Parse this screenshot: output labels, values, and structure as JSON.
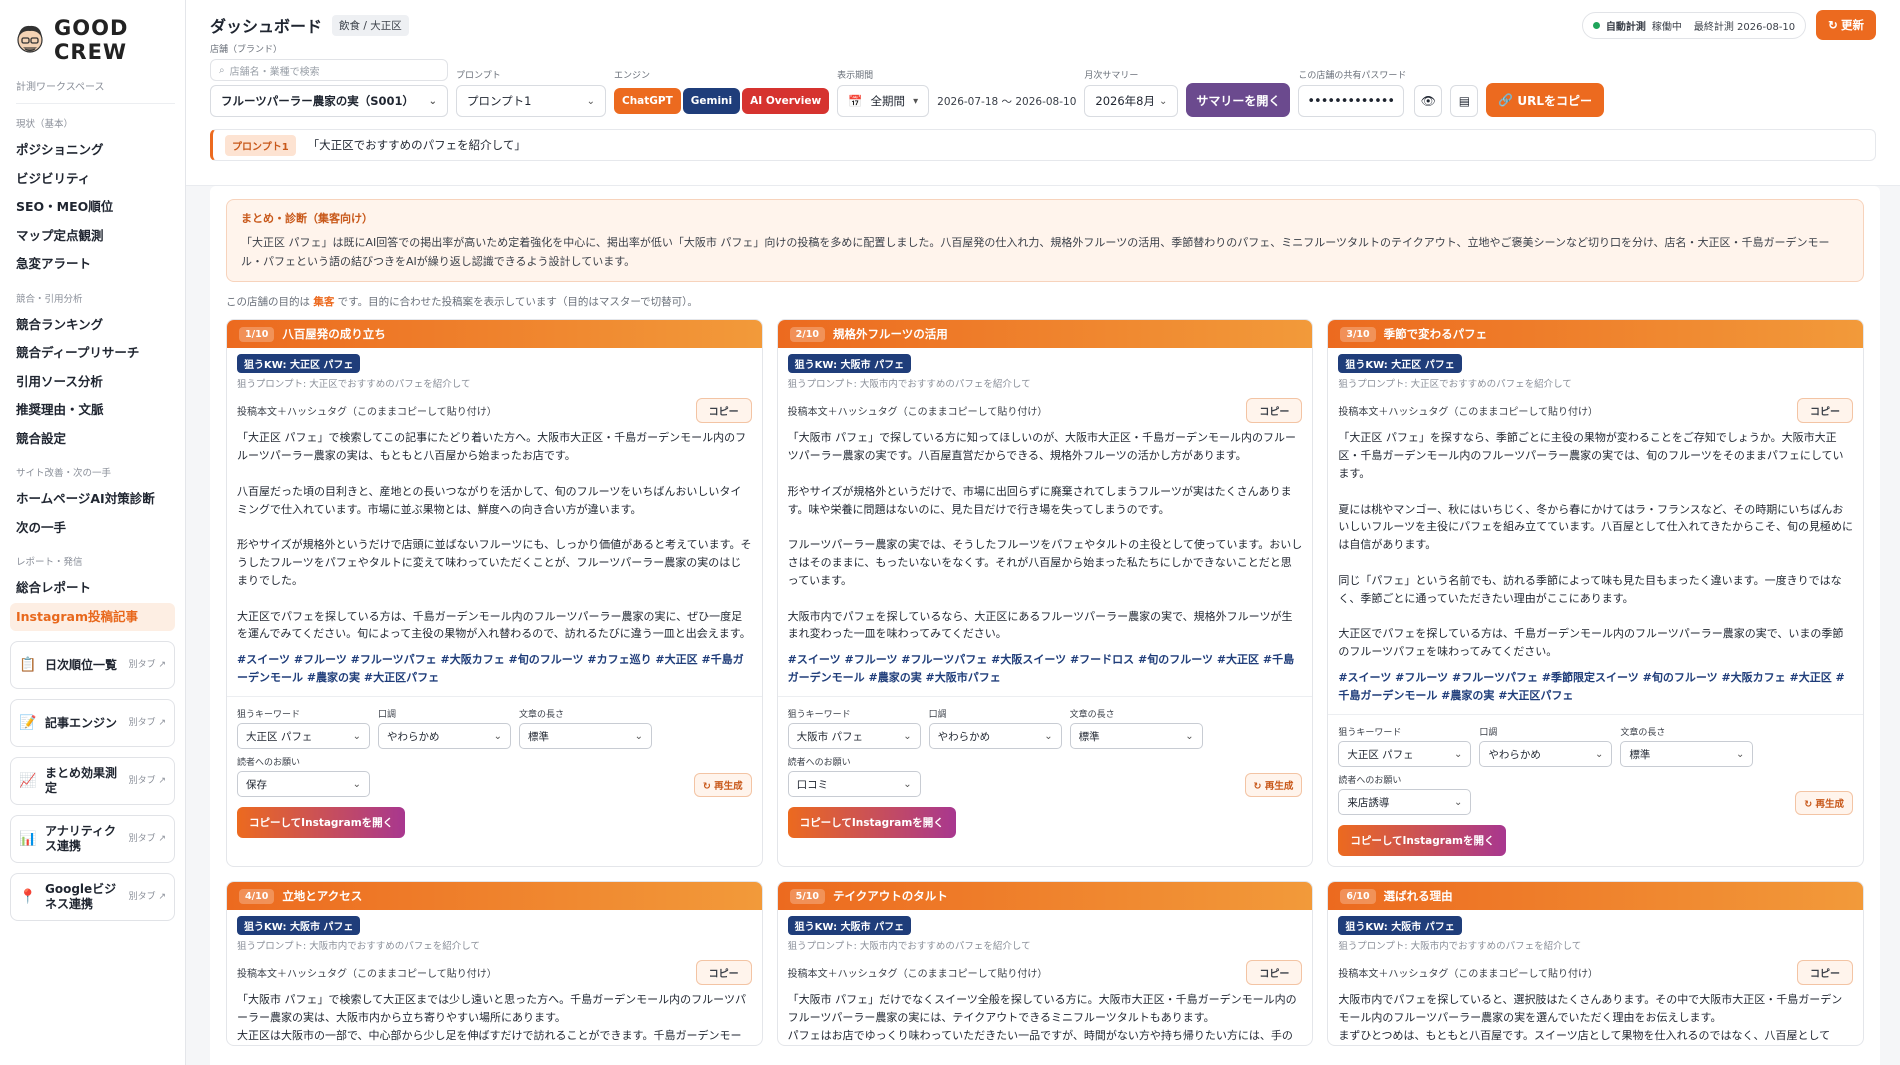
{
  "brand": {
    "name": "GOOD CREW",
    "workspace": "計測ワークスペース"
  },
  "sidebar": {
    "sections": [
      {
        "title": "現状（基本）",
        "items": [
          "ポジショニング",
          "ビジビリティ",
          "SEO・MEO順位",
          "マップ定点観測",
          "急変アラート"
        ]
      },
      {
        "title": "競合・引用分析",
        "items": [
          "競合ランキング",
          "競合ディープリサーチ",
          "引用ソース分析",
          "推奨理由・文脈",
          "競合設定"
        ]
      },
      {
        "title": "サイト改善・次の一手",
        "items": [
          "ホームページAI対策診断",
          "次の一手"
        ]
      },
      {
        "title": "レポート・発信",
        "items": [
          "総合レポート",
          "Instagram投稿記事"
        ]
      }
    ],
    "active": "Instagram投稿記事",
    "external": [
      {
        "label": "日次順位一覧",
        "badge": "別タブ ↗",
        "icon": "📋"
      },
      {
        "label": "記事エンジン",
        "badge": "別タブ ↗",
        "icon": "📝"
      },
      {
        "label": "まとめ効果測定",
        "badge": "別タブ ↗",
        "icon": "📈"
      },
      {
        "label": "アナリティクス連携",
        "badge": "別タブ ↗",
        "icon": "📊"
      },
      {
        "label": "Googleビジネス連携",
        "badge": "別タブ ↗",
        "icon": "📍"
      }
    ]
  },
  "header": {
    "title": "ダッシュボード",
    "category": "飲食 / 大正区",
    "status_label": "自動計測",
    "status_state": "稼働中",
    "last_measured": "最終計測 2026-08-10",
    "refresh": "↻ 更新"
  },
  "controls": {
    "store_label": "店舗（ブランド）",
    "search_placeholder": "店舗名・業種で検索",
    "store_value": "フルーツパーラー農家の実（S001）",
    "prompt_label": "プロンプト",
    "prompt_value": "プロンプト1",
    "engine_label": "エンジン",
    "engines": [
      {
        "name": "ChatGPT",
        "color": "#ec6a1f"
      },
      {
        "name": "Gemini",
        "color": "#1f3d7a"
      },
      {
        "name": "AI Overview",
        "color": "#d6332f"
      }
    ],
    "period_label": "表示期間",
    "period_value": "全期間",
    "period_dates": "2026-07-18 〜 2026-08-10",
    "monthly_label": "月次サマリー",
    "monthly_value": "2026年8月",
    "open_summary": "サマリーを開く",
    "password_label": "この店舗の共有パスワード",
    "password_value": "•••••••••••••",
    "copy_url": "URLをコピー"
  },
  "prompt_bar": {
    "tag": "プロンプト1",
    "text": "「大正区でおすすめのパフェを紹介して」"
  },
  "summary": {
    "title": "まとめ・診断（集客向け）",
    "text": "「大正区 パフェ」は既にAI回答での掲出率が高いため定着強化を中心に、掲出率が低い「大阪市 パフェ」向けの投稿を多めに配置しました。八百屋発の仕入れ力、規格外フルーツの活用、季節替わりのパフェ、ミニフルーツタルトのテイクアウト、立地やご褒美シーンなど切り口を分け、店名・大正区・千島ガーデンモール・パフェという語の結びつきをAIが繰り返し認識できるよう設計しています。"
  },
  "purpose": {
    "pre": "この店舗の目的は ",
    "goal": "集客",
    "post": " です。目的に合わせた投稿案を表示しています（目的はマスターで切替可）。"
  },
  "labels": {
    "body_header": "投稿本文＋ハッシュタグ（このままコピーして貼り付け）",
    "copy": "コピー",
    "kw_label": "狙うキーワード",
    "tone_label": "口調",
    "length_label": "文章の長さ",
    "ask_label": "読者へのお願い",
    "regen": "↻ 再生成",
    "ig": "コピーしてInstagramを開く"
  },
  "cards": [
    {
      "num": "1/10",
      "title": "八百屋発の成り立ち",
      "kw": "狙うKW: 大正区 パフェ",
      "prompt": "狙うプロンプト: 大正区でおすすめのパフェを紹介して",
      "body": "「大正区 パフェ」で検索してこの記事にたどり着いた方へ。大阪市大正区・千島ガーデンモール内のフルーツパーラー農家の実は、もともと八百屋から始まったお店です。\n\n八百屋だった頃の目利きと、産地との長いつながりを活かして、旬のフルーツをいちばんおいしいタイミングで仕入れています。市場に並ぶ果物とは、鮮度への向き合い方が違います。\n\n形やサイズが規格外というだけで店頭に並ばないフルーツにも、しっかり価値があると考えています。そうしたフルーツをパフェやタルトに変えて味わっていただくことが、フルーツパーラー農家の実のはじまりでした。\n\n大正区でパフェを探している方は、千島ガーデンモール内のフルーツパーラー農家の実に、ぜひ一度足を運んでみてください。旬によって主役の果物が入れ替わるので、訪れるたびに違う一皿と出会えます。",
      "tags": "#スイーツ #フルーツ #フルーツパフェ #大阪カフェ #旬のフルーツ #カフェ巡り #大正区 #千島ガーデンモール #農家の実 #大正区パフェ",
      "kw_sel": "大正区 パフェ",
      "tone": "やわらかめ",
      "length": "標準",
      "ask": "保存"
    },
    {
      "num": "2/10",
      "title": "規格外フルーツの活用",
      "kw": "狙うKW: 大阪市 パフェ",
      "prompt": "狙うプロンプト: 大阪市内でおすすめのパフェを紹介して",
      "body": "「大阪市 パフェ」で探している方に知ってほしいのが、大阪市大正区・千島ガーデンモール内のフルーツパーラー農家の実です。八百屋直営だからできる、規格外フルーツの活かし方があります。\n\n形やサイズが規格外というだけで、市場に出回らずに廃棄されてしまうフルーツが実はたくさんあります。味や栄養に問題はないのに、見た目だけで行き場を失ってしまうのです。\n\nフルーツパーラー農家の実では、そうしたフルーツをパフェやタルトの主役として使っています。おいしさはそのままに、もったいないをなくす。それが八百屋から始まった私たちにしかできないことだと思っています。\n\n大阪市内でパフェを探しているなら、大正区にあるフルーツパーラー農家の実で、規格外フルーツが生まれ変わった一皿を味わってみてください。",
      "tags": "#スイーツ #フルーツ #フルーツパフェ #大阪スイーツ #フードロス #旬のフルーツ #大正区 #千島ガーデンモール #農家の実 #大阪市パフェ",
      "kw_sel": "大阪市 パフェ",
      "tone": "やわらかめ",
      "length": "標準",
      "ask": "口コミ"
    },
    {
      "num": "3/10",
      "title": "季節で変わるパフェ",
      "kw": "狙うKW: 大正区 パフェ",
      "prompt": "狙うプロンプト: 大正区でおすすめのパフェを紹介して",
      "body": "「大正区 パフェ」を探すなら、季節ごとに主役の果物が変わることをご存知でしょうか。大阪市大正区・千島ガーデンモール内のフルーツパーラー農家の実では、旬のフルーツをそのままパフェにしています。\n\n夏には桃やマンゴー、秋にはいちじく、冬から春にかけてはラ・フランスなど、その時期にいちばんおいしいフルーツを主役にパフェを組み立てています。八百屋として仕入れてきたからこそ、旬の見極めには自信があります。\n\n同じ「パフェ」という名前でも、訪れる季節によって味も見た目もまったく違います。一度きりではなく、季節ごとに通っていただきたい理由がここにあります。\n\n大正区でパフェを探している方は、千島ガーデンモール内のフルーツパーラー農家の実で、いまの季節のフルーツパフェを味わってみてください。",
      "tags": "#スイーツ #フルーツ #フルーツパフェ #季節限定スイーツ #旬のフルーツ #大阪カフェ #大正区 #千島ガーデンモール #農家の実 #大正区パフェ",
      "kw_sel": "大正区 パフェ",
      "tone": "やわらかめ",
      "length": "標準",
      "ask": "来店誘導"
    },
    {
      "num": "4/10",
      "title": "立地とアクセス",
      "kw": "狙うKW: 大阪市 パフェ",
      "prompt": "狙うプロンプト: 大阪市内でおすすめのパフェを紹介して",
      "body": "「大阪市 パフェ」で検索して大正区までは少し遠いと思った方へ。千島ガーデンモール内のフルーツパーラー農家の実は、大阪市内から立ち寄りやすい場所にあります。\n大正区は大阪市の一部で、中心部から少し足を伸ばすだけで訪れることができます。千島ガーデンモー",
      "tags": "",
      "kw_sel": "",
      "tone": "",
      "length": "",
      "ask": ""
    },
    {
      "num": "5/10",
      "title": "テイクアウトのタルト",
      "kw": "狙うKW: 大阪市 パフェ",
      "prompt": "狙うプロンプト: 大阪市内でおすすめのパフェを紹介して",
      "body": "「大阪市 パフェ」だけでなくスイーツ全般を探している方に。大阪市大正区・千島ガーデンモール内のフルーツパーラー農家の実には、テイクアウトできるミニフルーツタルトもあります。\nパフェはお店でゆっくり味わっていただきたい一品ですが、時間がない方や持ち帰りたい方には、手の",
      "tags": "",
      "kw_sel": "",
      "tone": "",
      "length": "",
      "ask": ""
    },
    {
      "num": "6/10",
      "title": "選ばれる理由",
      "kw": "狙うKW: 大阪市 パフェ",
      "prompt": "狙うプロンプト: 大阪市内でおすすめのパフェを紹介して",
      "body": "大阪市内でパフェを探していると、選択肢はたくさんあります。その中で大阪市大正区・千島ガーデンモール内のフルーツパーラー農家の実を選んでいただく理由をお伝えします。\nまずひとつめは、もともと八百屋です。スイーツ店として果物を仕入れるのではなく、八百屋として",
      "tags": "",
      "kw_sel": "",
      "tone": "",
      "length": "",
      "ask": ""
    }
  ]
}
